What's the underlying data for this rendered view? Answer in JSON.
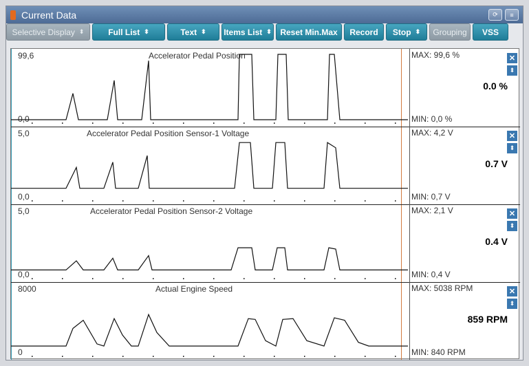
{
  "window": {
    "title": "Current Data",
    "icons": [
      "retry-icon",
      "menu-icon"
    ]
  },
  "toolbar": [
    {
      "id": "selective-display",
      "label": "Selective Display",
      "dropdown": true,
      "disabled": true,
      "width": 122
    },
    {
      "id": "full-list",
      "label": "Full List",
      "dropdown": true,
      "disabled": false,
      "width": 106
    },
    {
      "id": "text",
      "label": "Text",
      "dropdown": true,
      "disabled": false,
      "width": 76
    },
    {
      "id": "items-list",
      "label": "Items List",
      "dropdown": true,
      "disabled": false,
      "width": 76
    },
    {
      "id": "reset-minmax",
      "label": "Reset Min.Max",
      "dropdown": false,
      "disabled": false,
      "width": 96
    },
    {
      "id": "record",
      "label": "Record",
      "dropdown": false,
      "disabled": false,
      "width": 58
    },
    {
      "id": "stop",
      "label": "Stop",
      "dropdown": true,
      "disabled": false,
      "width": 60
    },
    {
      "id": "grouping",
      "label": "Grouping",
      "dropdown": false,
      "disabled": true,
      "width": 60
    },
    {
      "id": "vss",
      "label": "VSS",
      "dropdown": false,
      "disabled": false,
      "width": 52
    }
  ],
  "panels": [
    {
      "title": "Accelerator Pedal Position",
      "top_label": "99,6",
      "bottom_label": "0,0",
      "max": "MAX:  99,6 %",
      "min": "MIN:  0,0 %",
      "current": "0.0 %",
      "chart_data": {
        "type": "line",
        "ylim": [
          0,
          99.6
        ],
        "points": [
          [
            0,
            0
          ],
          [
            80,
            0
          ],
          [
            90,
            40
          ],
          [
            98,
            0
          ],
          [
            140,
            0
          ],
          [
            150,
            60
          ],
          [
            155,
            0
          ],
          [
            190,
            0
          ],
          [
            200,
            90
          ],
          [
            203,
            0
          ],
          [
            330,
            0
          ],
          [
            332,
            99.6
          ],
          [
            350,
            99.6
          ],
          [
            353,
            0
          ],
          [
            385,
            0
          ],
          [
            388,
            99.6
          ],
          [
            400,
            99.6
          ],
          [
            403,
            0
          ],
          [
            460,
            0
          ],
          [
            463,
            99.6
          ],
          [
            470,
            99.6
          ],
          [
            478,
            0
          ],
          [
            577,
            0
          ]
        ]
      }
    },
    {
      "title": "Accelerator Pedal Position Sensor-1 Voltage",
      "top_label": "5,0",
      "bottom_label": "0,0",
      "max": "MAX:   4,2 V",
      "min": "MIN:  0,7 V",
      "current": "0.7 V",
      "chart_data": {
        "type": "line",
        "ylim": [
          0,
          5
        ],
        "points": [
          [
            0,
            0.7
          ],
          [
            80,
            0.7
          ],
          [
            95,
            2.3
          ],
          [
            100,
            0.7
          ],
          [
            135,
            0.7
          ],
          [
            148,
            2.7
          ],
          [
            152,
            0.7
          ],
          [
            185,
            0.7
          ],
          [
            198,
            3.2
          ],
          [
            201,
            0.7
          ],
          [
            325,
            0.7
          ],
          [
            332,
            4.2
          ],
          [
            348,
            4.2
          ],
          [
            353,
            0.7
          ],
          [
            380,
            0.7
          ],
          [
            385,
            4.2
          ],
          [
            398,
            4.2
          ],
          [
            402,
            0.7
          ],
          [
            455,
            0.7
          ],
          [
            460,
            4.2
          ],
          [
            472,
            3.8
          ],
          [
            478,
            0.7
          ],
          [
            577,
            0.7
          ]
        ]
      }
    },
    {
      "title": "Accelerator Pedal Position Sensor-2 Voltage",
      "top_label": "5,0",
      "bottom_label": "0,0",
      "max": "MAX:   2,1 V",
      "min": "MIN:  0,4 V",
      "current": "0.4 V",
      "chart_data": {
        "type": "line",
        "ylim": [
          0,
          5
        ],
        "points": [
          [
            0,
            0.4
          ],
          [
            80,
            0.4
          ],
          [
            95,
            1.1
          ],
          [
            105,
            0.4
          ],
          [
            135,
            0.4
          ],
          [
            148,
            1.3
          ],
          [
            155,
            0.4
          ],
          [
            185,
            0.4
          ],
          [
            200,
            1.5
          ],
          [
            205,
            0.4
          ],
          [
            320,
            0.4
          ],
          [
            330,
            2.1
          ],
          [
            350,
            2.1
          ],
          [
            355,
            0.4
          ],
          [
            380,
            0.4
          ],
          [
            387,
            2.1
          ],
          [
            398,
            2.1
          ],
          [
            402,
            0.4
          ],
          [
            455,
            0.4
          ],
          [
            462,
            2.1
          ],
          [
            472,
            2.0
          ],
          [
            478,
            0.4
          ],
          [
            577,
            0.4
          ]
        ]
      }
    },
    {
      "title": "Actual Engine Speed",
      "top_label": "8000",
      "bottom_label": "0",
      "max": "MAX:  5038 RPM",
      "min": "MIN:  840 RPM",
      "current": "859 RPM",
      "chart_data": {
        "type": "line",
        "ylim": [
          0,
          8000
        ],
        "points": [
          [
            0,
            840
          ],
          [
            80,
            840
          ],
          [
            90,
            3000
          ],
          [
            105,
            4000
          ],
          [
            125,
            1100
          ],
          [
            135,
            840
          ],
          [
            150,
            4200
          ],
          [
            162,
            2200
          ],
          [
            175,
            840
          ],
          [
            185,
            840
          ],
          [
            200,
            4700
          ],
          [
            212,
            2500
          ],
          [
            230,
            840
          ],
          [
            330,
            840
          ],
          [
            345,
            4200
          ],
          [
            355,
            4100
          ],
          [
            370,
            1500
          ],
          [
            385,
            840
          ],
          [
            395,
            4100
          ],
          [
            410,
            4200
          ],
          [
            430,
            1500
          ],
          [
            455,
            840
          ],
          [
            470,
            4300
          ],
          [
            485,
            4000
          ],
          [
            505,
            1300
          ],
          [
            520,
            840
          ],
          [
            577,
            840
          ]
        ]
      }
    }
  ]
}
